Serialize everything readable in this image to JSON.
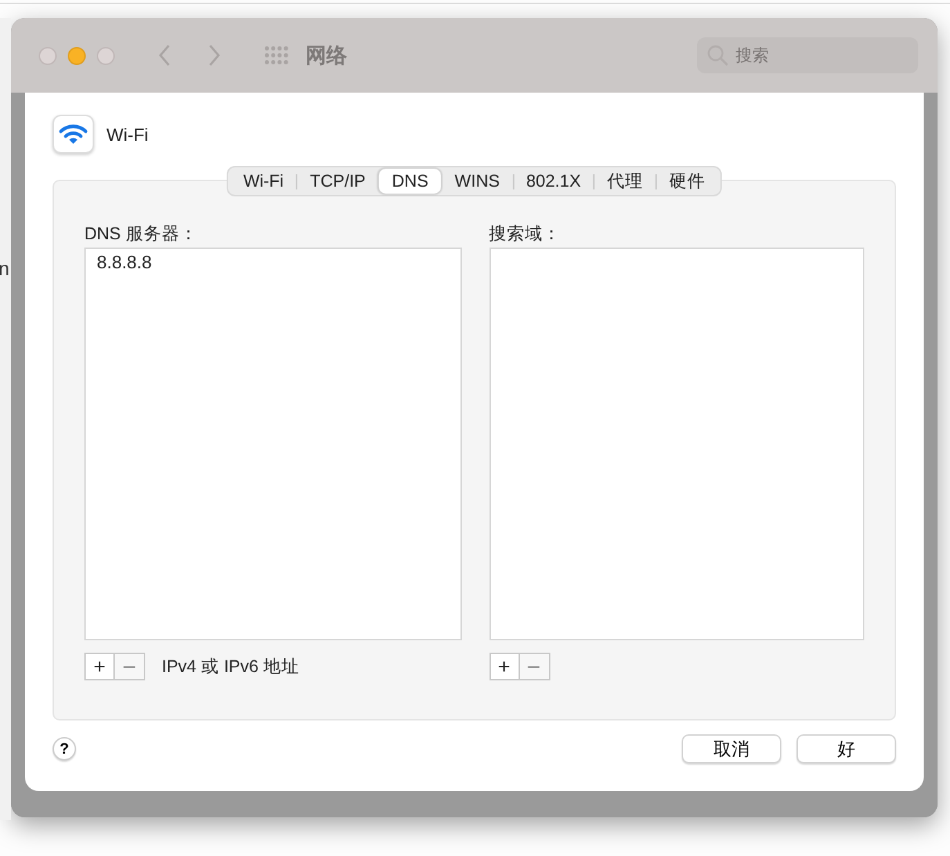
{
  "window": {
    "title": "网络",
    "search": {
      "placeholder": "搜索"
    }
  },
  "background_fragments": {
    "left": [
      "n"
    ]
  },
  "sheet": {
    "service": "Wi-Fi",
    "tabs": [
      {
        "label": "Wi-Fi",
        "selected": false
      },
      {
        "label": "TCP/IP",
        "selected": false
      },
      {
        "label": "DNS",
        "selected": true
      },
      {
        "label": "WINS",
        "selected": false
      },
      {
        "label": "802.1X",
        "selected": false
      },
      {
        "label": "代理",
        "selected": false
      },
      {
        "label": "硬件",
        "selected": false
      }
    ],
    "dns_servers": {
      "label": "DNS 服务器：",
      "items": [
        "8.8.8.8"
      ],
      "controls": [
        {
          "symbol": "+",
          "disabled": false
        },
        {
          "symbol": "−",
          "disabled": true
        }
      ],
      "hint": "IPv4 或 IPv6 地址"
    },
    "search_domains": {
      "label": "搜索域：",
      "controls": [
        {
          "symbol": "+",
          "disabled": false
        },
        {
          "symbol": "−",
          "disabled": true
        }
      ]
    },
    "help": "?",
    "buttons": [
      "取消",
      "好"
    ]
  }
}
